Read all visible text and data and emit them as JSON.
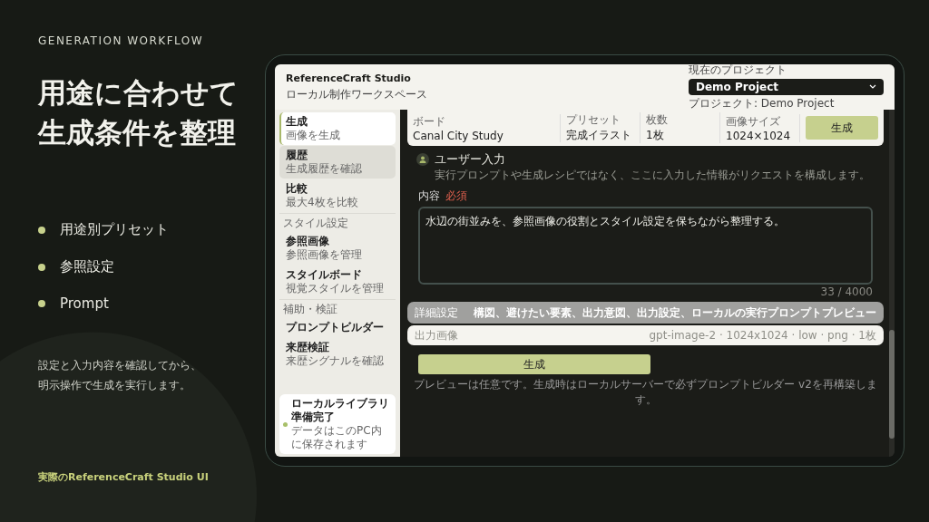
{
  "slide": {
    "eyebrow": "GENERATION WORKFLOW",
    "headline": [
      "用途に合わせて",
      "生成条件を整理"
    ],
    "bullets": [
      "用途別プリセット",
      "参照設定",
      "Prompt"
    ],
    "description": "設定と入力内容を確認してから、明示操作で生成を実行します。",
    "footer": "実際のReferenceCraft Studio UI"
  },
  "app": {
    "title": "ReferenceCraft Studio",
    "subtitle": "ローカル制作ワークスペース",
    "project": {
      "label": "現在のプロジェクト",
      "value": "Demo Project",
      "caption": "プロジェクト: Demo Project"
    },
    "sidebar": [
      {
        "kind": "item",
        "title": "生成",
        "caption": "画像を生成",
        "selected": true,
        "hovered": false
      },
      {
        "kind": "item",
        "title": "履歴",
        "caption": "生成履歴を確認",
        "selected": false,
        "hovered": true
      },
      {
        "kind": "item",
        "title": "比較",
        "caption": "最大4枚を比較",
        "selected": false,
        "hovered": false
      },
      {
        "kind": "section",
        "title": "スタイル設定"
      },
      {
        "kind": "item",
        "title": "参照画像",
        "caption": "参照画像を管理",
        "selected": false,
        "hovered": false
      },
      {
        "kind": "item",
        "title": "スタイルボード",
        "caption": "視覚スタイルを管理",
        "selected": false,
        "hovered": false
      },
      {
        "kind": "section",
        "title": "補助・検証"
      },
      {
        "kind": "item",
        "title": "プロンプトビルダー",
        "selected": false,
        "hovered": false
      },
      {
        "kind": "item",
        "title": "来歴検証",
        "caption": "来歴シグナルを確認",
        "selected": false,
        "hovered": false
      }
    ],
    "status": {
      "title": "ローカルライブラリ準備完了",
      "caption": "データはこのPC内に保存されます",
      "color": "#a8c06a"
    },
    "summary": [
      {
        "label": "ボード",
        "value": "Canal City Study"
      },
      {
        "label": "プリセット",
        "value": "完成イラスト"
      },
      {
        "label": "枚数",
        "value": "1枚"
      },
      {
        "label": "画像サイズ",
        "value": "1024×1024"
      }
    ],
    "summary_button": "生成",
    "section": {
      "title": "ユーザー入力",
      "hint": "実行プロンプトや生成レシピではなく、ここに入力した情報がリクエストを構成します。"
    },
    "field": {
      "label": "内容",
      "badge": "必須",
      "value": "水辺の街並みを、参照画像の役割とスタイル設定を保ちながら整理する。",
      "counter": "33 / 4000"
    },
    "details": {
      "title": "詳細設定",
      "summary": "構図、避けたい要素、出力意図、出力設定、ローカルの実行プロンプトプレビュー"
    },
    "output": {
      "title": "出力画像",
      "summary": "gpt-image-2 · 1024x1024 · low · png · 1枚"
    },
    "generate_button": "生成",
    "footnote": "プレビューは任意です。生成時はローカルサーバーで必ずプロンプトビルダー v2を再構築します。"
  }
}
